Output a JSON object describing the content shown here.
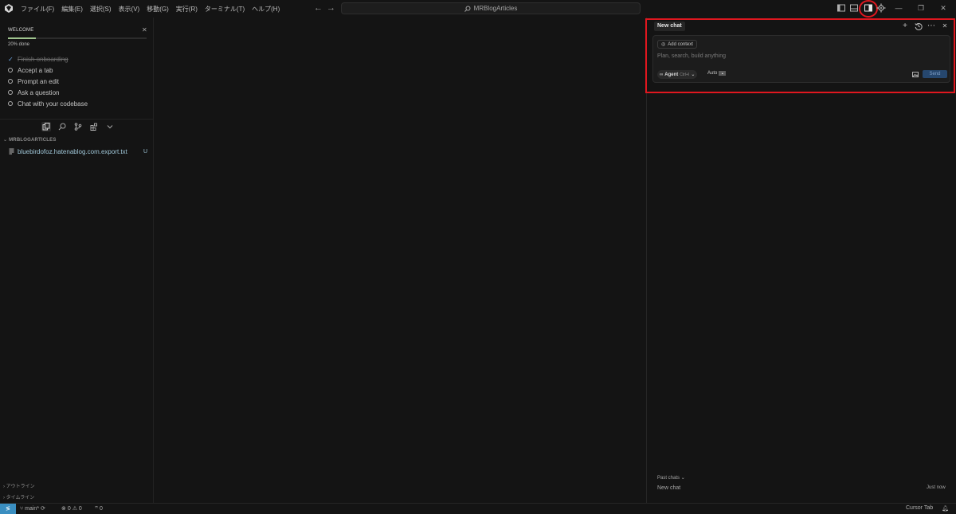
{
  "titlebar": {
    "menu": [
      "ファイル(F)",
      "編集(E)",
      "選択(S)",
      "表示(V)",
      "移動(G)",
      "実行(R)",
      "ターミナル(T)",
      "ヘルプ(H)"
    ],
    "search_text": "MRBlogArticles"
  },
  "welcome": {
    "title": "WELCOME",
    "progress": 0.2,
    "progress_text": "20% done",
    "items": [
      {
        "label": "Finish onboarding",
        "done": true
      },
      {
        "label": "Accept a tab",
        "done": false
      },
      {
        "label": "Prompt an edit",
        "done": false
      },
      {
        "label": "Ask a question",
        "done": false
      },
      {
        "label": "Chat with your codebase",
        "done": false
      }
    ]
  },
  "explorer": {
    "section_title": "MRBLOGARTICLES",
    "file_name": "bluebirdofoz.hatenablog.com.export.txt",
    "file_badge": "U",
    "outline_label": "アウトライン",
    "timeline_label": "タイムライン"
  },
  "chat": {
    "tab_label": "New chat",
    "add_context_label": "Add context",
    "placeholder": "Plan, search, build anything",
    "agent_label": "Agent",
    "agent_shortcut": "Ctrl+I",
    "model_label": "Auto",
    "send_label": "Send",
    "past_chats_label": "Past chats",
    "past_item_label": "New chat",
    "past_item_time": "Just now"
  },
  "statusbar": {
    "branch": "main*",
    "errors": "0",
    "warnings": "0",
    "ports": "0",
    "right_label": "Cursor Tab"
  },
  "colors": {
    "highlight": "#e0171f",
    "progress": "#9fc38e",
    "send": "#26476e",
    "remote": "#3a8ec0"
  }
}
